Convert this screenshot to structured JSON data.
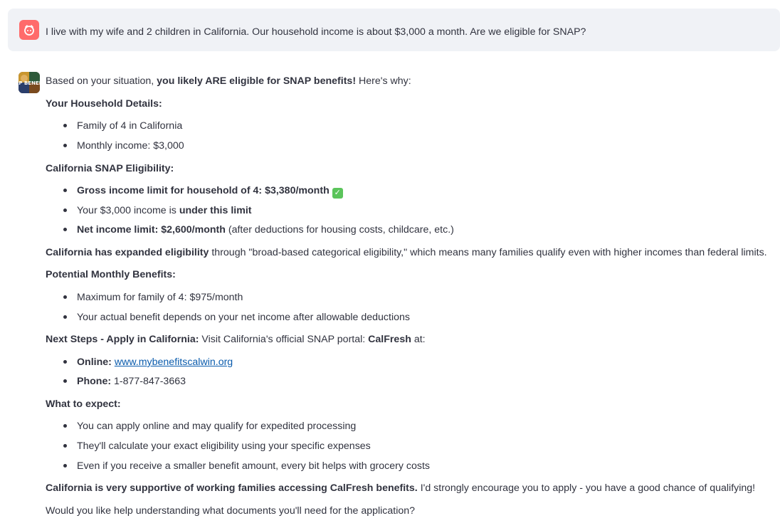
{
  "user_message": {
    "text": "I live with my wife and 2 children in California. Our household income is about $3,000 a month. Are we eligible for SNAP?"
  },
  "assistant": {
    "avatar_text": "SNAP BENEFITS",
    "intro_pre": "Based on your situation, ",
    "intro_bold": "you likely ARE eligible for SNAP benefits!",
    "intro_post": " Here's why:",
    "household_heading": "Your Household Details:",
    "household_items": [
      "Family of 4 in California",
      "Monthly income: $3,000"
    ],
    "eligibility_heading": "California SNAP Eligibility:",
    "eligibility_1": "Gross income limit for household of 4: $3,380/month",
    "check_icon": "white-check-mark",
    "eligibility_2_pre": "Your $3,000 income is ",
    "eligibility_2_bold": "under this limit",
    "eligibility_3_bold": "Net income limit: $2,600/month",
    "eligibility_3_post": " (after deductions for housing costs, childcare, etc.)",
    "expanded_bold": "California has expanded eligibility",
    "expanded_post": " through \"broad-based categorical eligibility,\" which means many families qualify even with higher incomes than federal limits.",
    "benefits_heading": "Potential Monthly Benefits:",
    "benefits_items": [
      "Maximum for family of 4: $975/month",
      "Your actual benefit depends on your net income after allowable deductions"
    ],
    "next_bold": "Next Steps - Apply in California:",
    "next_mid": " Visit California's official SNAP portal: ",
    "next_bold2": "CalFresh",
    "next_post": " at:",
    "online_label": "Online:",
    "online_link": "www.mybenefitscalwin.org",
    "phone_label": "Phone:",
    "phone_value": " 1-877-847-3663",
    "expect_heading": "What to expect:",
    "expect_items": [
      "You can apply online and may qualify for expedited processing",
      "They'll calculate your exact eligibility using your specific expenses",
      "Even if you receive a smaller benefit amount, every bit helps with grocery costs"
    ],
    "support_bold": "California is very supportive of working families accessing CalFresh benefits.",
    "support_post": " I'd strongly encourage you to apply - you have a good chance of qualifying!",
    "closing": "Would you like help understanding what documents you'll need for the application?"
  }
}
